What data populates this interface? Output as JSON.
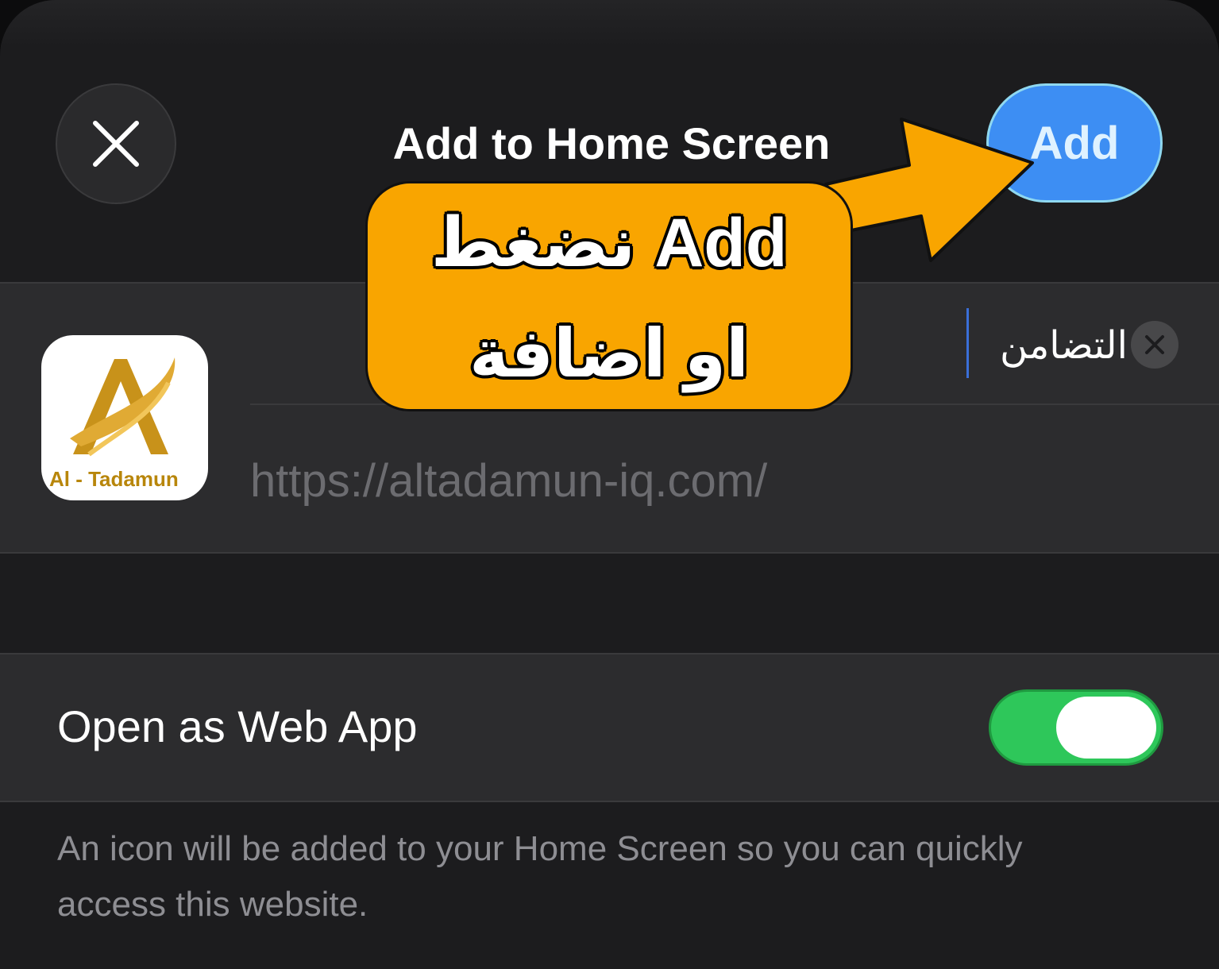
{
  "header": {
    "title": "Add to Home Screen",
    "add_label": "Add",
    "close_icon": "close-icon"
  },
  "bookmark": {
    "icon_label": "Al - Tadamun",
    "name_value": "التضامن",
    "url": "https://altadamun-iq.com/"
  },
  "web_app": {
    "label": "Open as Web App",
    "enabled": true
  },
  "footer": {
    "note": "An icon will be added to your Home Screen so you can quickly access this website."
  },
  "annotation": {
    "line1": "نضغط Add",
    "line2": "او اضافة"
  },
  "colors": {
    "accent": "#3d8ef3",
    "toggle_on": "#2ec75a",
    "callout": "#f9a500"
  }
}
